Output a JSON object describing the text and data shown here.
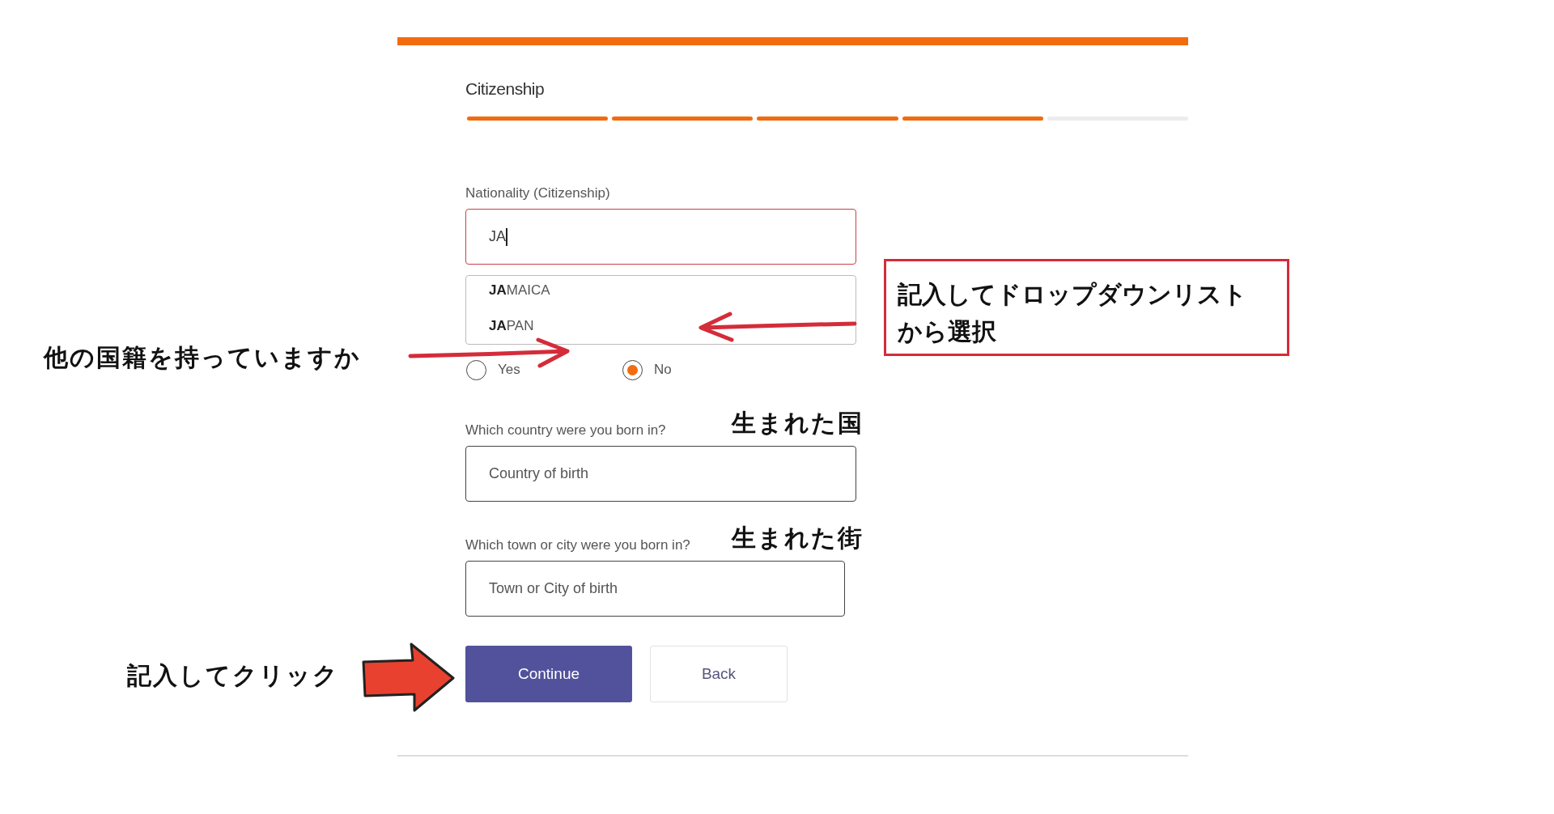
{
  "section_title": "Citizenship",
  "progress_steps": [
    {
      "done": true
    },
    {
      "done": true
    },
    {
      "done": true
    },
    {
      "done": true
    },
    {
      "done": false
    }
  ],
  "nationality": {
    "label": "Nationality (Citizenship)",
    "value": "JA",
    "invalid": true,
    "suggestions": [
      {
        "text": "**JA**MAICA"
      },
      {
        "text": "**JA**PAN"
      }
    ]
  },
  "other_citizenship": [
    {
      "label": "Yes",
      "selected": false
    },
    {
      "label": "No",
      "selected": true
    }
  ],
  "birth_country": {
    "label": "Which country were you born in?",
    "placeholder": "Country of birth"
  },
  "birth_town": {
    "label": "Which town or city were you born in?",
    "placeholder": "Town or City of birth"
  },
  "buttons": [
    {
      "label": "Continue",
      "kind": "primary"
    },
    {
      "label": "Back",
      "kind": "secondary"
    }
  ],
  "annotations": [
    {
      "text": "記入してドロップダウンリストから選択",
      "kind": "callout"
    },
    {
      "text": "他の国籍を持っていますか",
      "kind": "note"
    },
    {
      "text": "生まれた国",
      "kind": "note"
    },
    {
      "text": "生まれた街",
      "kind": "note"
    },
    {
      "text": "記入してクリック",
      "kind": "note"
    }
  ]
}
